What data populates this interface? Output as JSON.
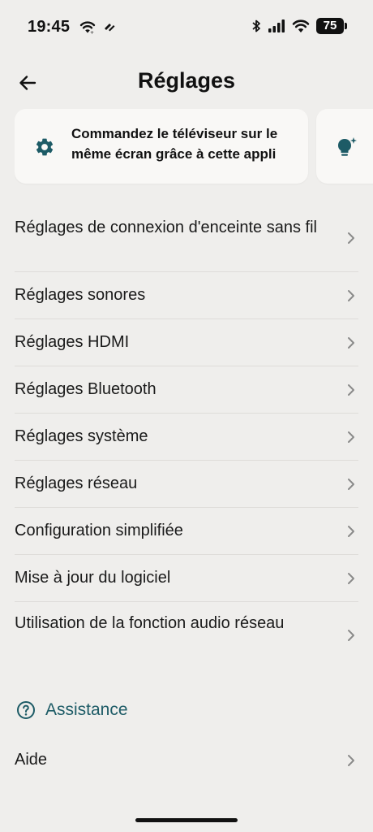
{
  "status_bar": {
    "time": "19:45",
    "battery": "75",
    "icons": [
      "wifi-icon",
      "hotspot-icon",
      "bluetooth-icon",
      "signal-icon",
      "wifi-icon",
      "battery-icon"
    ]
  },
  "header": {
    "title": "Réglages",
    "back_icon": "arrow-left-icon"
  },
  "cards": [
    {
      "icon": "gear-icon",
      "text": "Commandez le téléviseur sur le même écran grâce à cette appli"
    },
    {
      "icon": "lightbulb-sparkle-icon"
    }
  ],
  "settings_list": [
    {
      "label": "Réglages de connexion d'enceinte sans fil"
    },
    {
      "label": "Réglages sonores"
    },
    {
      "label": "Réglages HDMI"
    },
    {
      "label": "Réglages Bluetooth"
    },
    {
      "label": "Réglages système"
    },
    {
      "label": "Réglages réseau"
    },
    {
      "label": "Configuration simplifiée"
    },
    {
      "label": "Mise à jour du logiciel"
    },
    {
      "label": "Utilisation de la fonction audio réseau"
    }
  ],
  "assistance": {
    "title": "Assistance",
    "icon": "question-circle-icon",
    "items": [
      {
        "label": "Aide"
      }
    ]
  },
  "colors": {
    "background": "#efeeec",
    "card": "#f9f8f6",
    "accent": "#1d5b66",
    "divider": "#dedcd9"
  }
}
